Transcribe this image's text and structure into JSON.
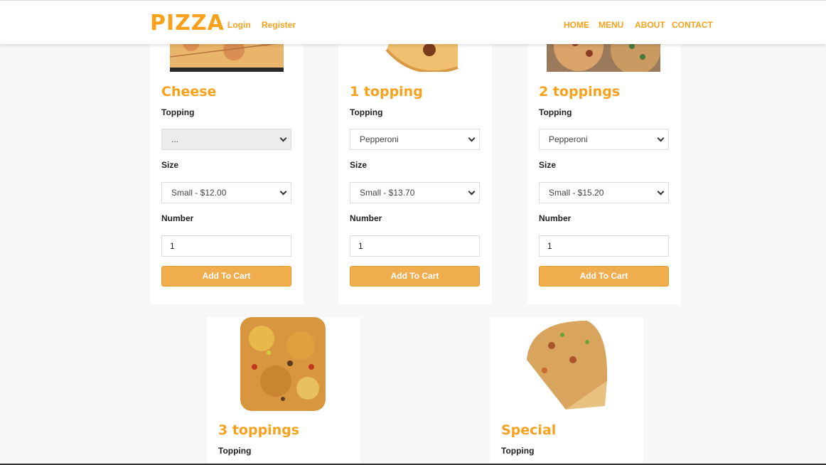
{
  "nav": {
    "brand": "PIZZA",
    "login": "Login",
    "register": "Register",
    "links": [
      "HOME",
      "MENU",
      "ABOUT",
      "CONTACT"
    ]
  },
  "labels": {
    "topping": "Topping",
    "size": "Size",
    "number": "Number",
    "add_to_cart": "Add To Cart"
  },
  "products": [
    {
      "title": "Cheese",
      "topping": "...",
      "size": "Small - $12.00",
      "number": "1"
    },
    {
      "title": "1 topping",
      "topping": "Pepperoni",
      "size": "Small - $13.70",
      "number": "1"
    },
    {
      "title": "2 toppings",
      "topping": "Pepperoni",
      "size": "Small - $15.20",
      "number": "1"
    },
    {
      "title": "3 toppings"
    },
    {
      "title": "Special"
    }
  ],
  "colors": {
    "accent": "#f8a11c",
    "button": "#f0ad4e",
    "background": "#f7f7f7"
  }
}
